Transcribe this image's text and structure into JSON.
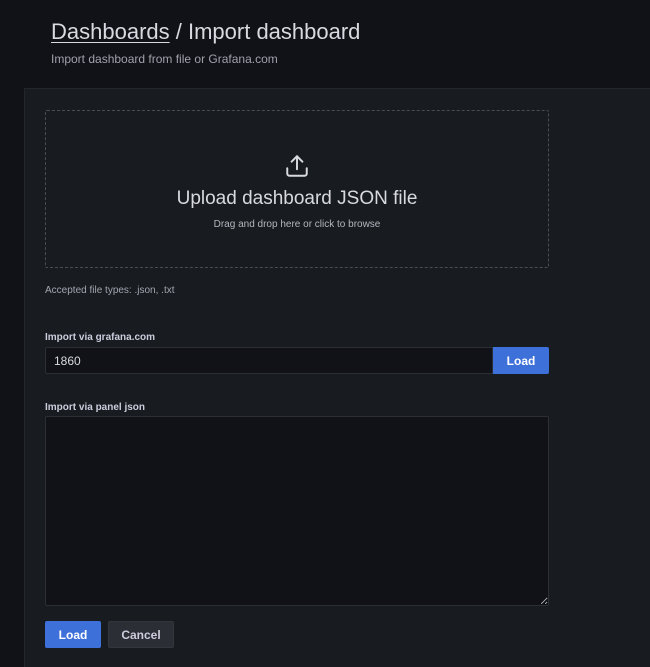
{
  "header": {
    "breadcrumb_link": "Dashboards",
    "separator": " / ",
    "title": "Import dashboard",
    "subtitle": "Import dashboard from file or Grafana.com"
  },
  "upload": {
    "icon": "upload-icon",
    "title": "Upload dashboard JSON file",
    "hint": "Drag and drop here or click to browse",
    "accepted": "Accepted file types: .json, .txt"
  },
  "grafana_com": {
    "label": "Import via grafana.com",
    "value": "1860",
    "load_label": "Load"
  },
  "panel_json": {
    "label": "Import via panel json",
    "value": ""
  },
  "actions": {
    "load_label": "Load",
    "cancel_label": "Cancel"
  },
  "colors": {
    "background": "#111217",
    "panel": "#181b1f",
    "primary": "#3d71d9"
  }
}
